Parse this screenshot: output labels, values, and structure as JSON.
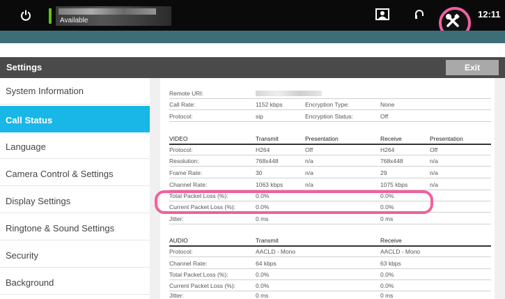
{
  "statusbar": {
    "status_text": "Available",
    "time": "12:11",
    "accent_green": "#5ac21c",
    "highlight_color": "#f0609e",
    "icons": [
      "power-icon",
      "share-screen-icon",
      "headset-icon",
      "settings-tools-icon"
    ]
  },
  "settings": {
    "title": "Settings",
    "exit_label": "Exit"
  },
  "sidebar": {
    "items": [
      {
        "label": "System Information"
      },
      {
        "label": "Call Status"
      },
      {
        "label": "Language"
      },
      {
        "label": "Camera Control & Settings"
      },
      {
        "label": "Display Settings"
      },
      {
        "label": "Ringtone & Sound Settings"
      },
      {
        "label": "Security"
      },
      {
        "label": "Background"
      }
    ],
    "active_index": 1,
    "active_color": "#19b6e8"
  },
  "call": {
    "remote_uri_label": "Remote URI:",
    "call_rate_label": "Call Rate:",
    "call_rate_value": "1152 kbps",
    "encryption_type_label": "Encryption Type:",
    "encryption_type_value": "None",
    "protocol_label": "Protocol:",
    "protocol_value": "sip",
    "encryption_status_label": "Encryption Status:",
    "encryption_status_value": "Off"
  },
  "video": {
    "headers": [
      "VIDEO",
      "Transmit",
      "Presentation",
      "Receive",
      "Presentation"
    ],
    "rows": [
      [
        "Protocol:",
        "H264",
        "Off",
        "H264",
        "Off"
      ],
      [
        "Resolution:",
        "768x448",
        "n/a",
        "768x448",
        "n/a"
      ],
      [
        "Frame Rate:",
        "30",
        "n/a",
        "29",
        "n/a"
      ],
      [
        "Channel Rate:",
        "1063 kbps",
        "n/a",
        "1075 kbps",
        "n/a"
      ],
      [
        "Total Packet Loss (%):",
        "0.0%",
        "",
        "0.0%",
        ""
      ],
      [
        "Current Packet Loss (%):",
        "0.0%",
        "",
        "0.0%",
        ""
      ],
      [
        "Jitter:",
        "0 ms",
        "",
        "0 ms",
        ""
      ]
    ]
  },
  "audio": {
    "headers": [
      "AUDIO",
      "Transmit",
      "Receive"
    ],
    "rows": [
      [
        "Protocol:",
        "AACLD - Mono",
        "AACLD - Mono"
      ],
      [
        "Channel Rate:",
        "64 kbps",
        "63 kbps"
      ],
      [
        "Total Packet Loss (%):",
        "0.0%",
        "0.0%"
      ],
      [
        "Current Packet Loss (%):",
        "0.0%",
        "0.0%"
      ],
      [
        "Jitter:",
        "0 ms",
        "0 ms"
      ]
    ]
  }
}
